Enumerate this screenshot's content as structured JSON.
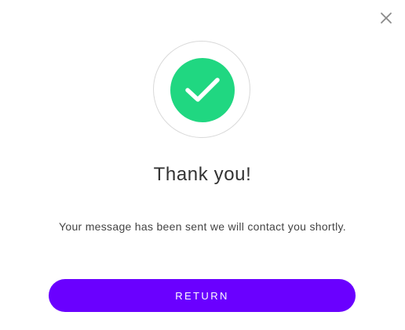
{
  "icons": {
    "close": "close-icon",
    "success": "checkmark-icon"
  },
  "colors": {
    "success_green": "#20d781",
    "ring_border": "#d9d9d9",
    "primary_purple": "#6a00ff",
    "title_text": "#333333",
    "body_text": "#444444",
    "close_icon": "#8a8a8a"
  },
  "dialog": {
    "title": "Thank you!",
    "message": "Your message has been sent we will contact you shortly.",
    "return_label": "RETURN"
  }
}
